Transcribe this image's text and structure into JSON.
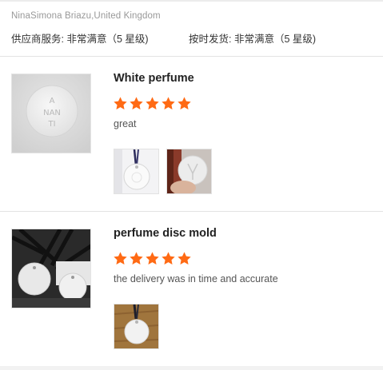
{
  "reviewer": {
    "name_country": "NinaSimona Briazu,United Kingdom"
  },
  "service_ratings": {
    "supplier_service": "供应商服务: 非常满意（5 星级)",
    "on_time_shipping": "按时发货: 非常满意（5 星级)"
  },
  "colors": {
    "star": "#ff6a14",
    "divider": "#e3e3e3",
    "muted_text": "#999999"
  },
  "reviews": [
    {
      "product_thumb_icon": "white-disc-logo-image",
      "product_title": "White perfume",
      "rating": 5,
      "rating_max": 5,
      "comment": "great",
      "photos": [
        "disc-on-ribbon-photo",
        "disc-held-in-hand-photo"
      ]
    },
    {
      "product_thumb_icon": "disc-with-black-ribbons-image",
      "product_title": "perfume disc mold",
      "rating": 5,
      "rating_max": 5,
      "comment": "the delivery was in time and accurate",
      "photos": [
        "disc-on-wood-photo"
      ]
    }
  ]
}
